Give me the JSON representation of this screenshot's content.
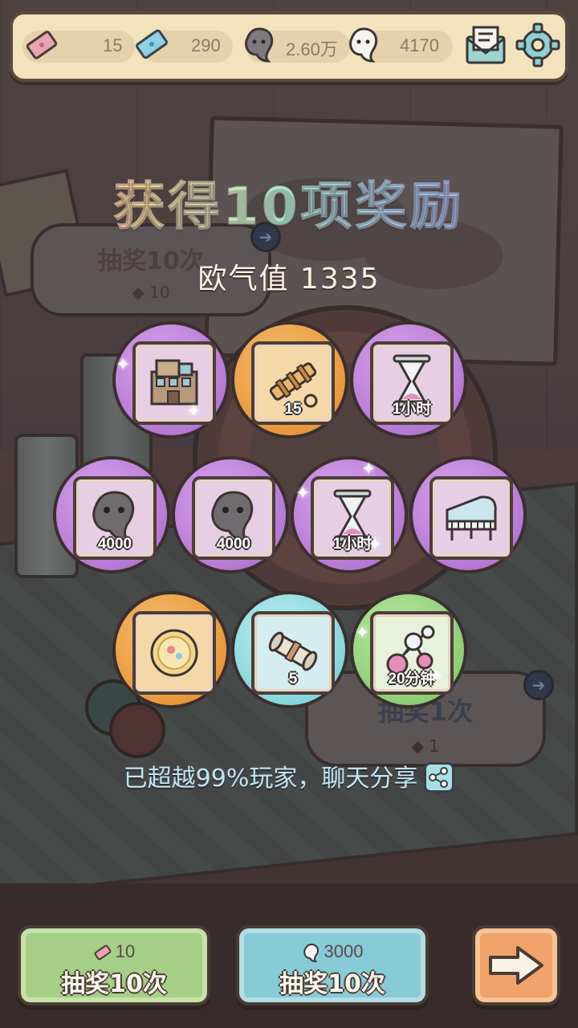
{
  "resources": {
    "ticket": "15",
    "blue_ticket": "290",
    "dark_soul": "2.60万",
    "white_soul": "4170"
  },
  "background": {
    "left_bubble": {
      "title": "抽奖10次",
      "cost": "10"
    },
    "right_bubble": {
      "title": "抽奖1次",
      "cost": "1"
    }
  },
  "title": "获得10项奖励",
  "luck_value": "欧气值 1335",
  "rewards": [
    {
      "icon": "building-icon",
      "color": "purple",
      "qty": ""
    },
    {
      "icon": "telescope-icon",
      "color": "orange",
      "qty": "15"
    },
    {
      "icon": "hourglass-icon",
      "color": "purple",
      "qty": "1小时"
    },
    {
      "icon": "dark-soul-icon",
      "color": "purple",
      "qty": "4000"
    },
    {
      "icon": "dark-soul-icon",
      "color": "purple",
      "qty": "4000"
    },
    {
      "icon": "hourglass-icon",
      "color": "purple",
      "qty": "1小时"
    },
    {
      "icon": "piano-icon",
      "color": "purple",
      "qty": ""
    },
    {
      "icon": "gold-coin-icon",
      "color": "orange",
      "qty": ""
    },
    {
      "icon": "scroll-icon",
      "color": "cyan",
      "qty": "5"
    },
    {
      "icon": "molecule-icon",
      "color": "green",
      "qty": "20分钟"
    }
  ],
  "share_text": "已超越99%玩家，聊天分享",
  "buttons": {
    "draw_ticket": {
      "cost": "10",
      "label": "抽奖10次"
    },
    "draw_soul": {
      "cost": "3000",
      "label": "抽奖10次"
    }
  },
  "colors": {
    "purple": "#b67ad4",
    "orange": "#e9993c",
    "cyan": "#86d6db",
    "green": "#8fcd76",
    "share_text": "#bfe4f2"
  }
}
